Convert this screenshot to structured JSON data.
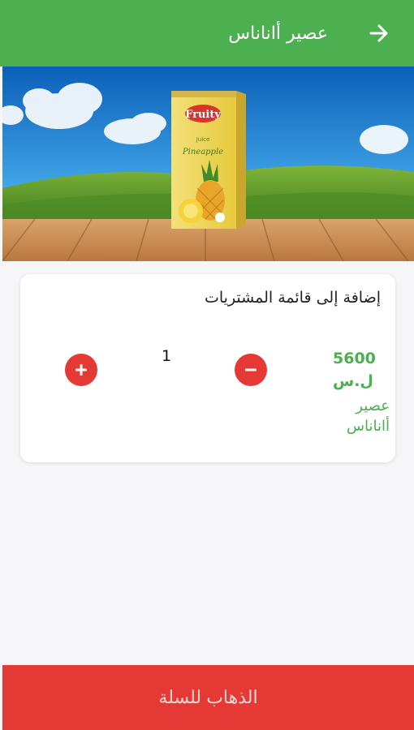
{
  "appbar": {
    "title": "عصير أاناناس",
    "back_icon": "arrow-right-icon",
    "color": "#4caf50"
  },
  "banner": {
    "brand": "Fruity",
    "subtitle": "Juice",
    "flavor": "Pineapple"
  },
  "card": {
    "title": "إضافة إلى قائمة المشتريات",
    "price": "5600",
    "currency": "ل.س",
    "product_name": "عصير أاناناس",
    "quantity": "1",
    "plus_icon": "plus-icon",
    "minus_icon": "minus-icon"
  },
  "footer": {
    "button_label": "الذهاب للسلة",
    "color": "#e53935"
  }
}
